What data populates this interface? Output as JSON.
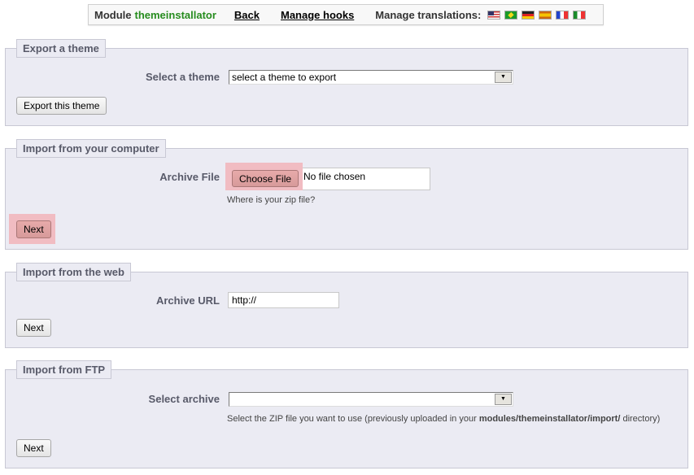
{
  "toolbar": {
    "module_prefix": "Module",
    "module_name": "themeinstallator",
    "back_label": "Back",
    "hooks_label": "Manage hooks",
    "translations_label": "Manage translations:",
    "flags": [
      {
        "icon": "flag-us-icon",
        "lang": "English"
      },
      {
        "icon": "flag-br-icon",
        "lang": "Portuguese"
      },
      {
        "icon": "flag-de-icon",
        "lang": "German"
      },
      {
        "icon": "flag-es-icon",
        "lang": "Spanish"
      },
      {
        "icon": "flag-fr-icon",
        "lang": "French"
      },
      {
        "icon": "flag-it-icon",
        "lang": "Italian"
      }
    ]
  },
  "export": {
    "legend": "Export a theme",
    "select_label": "Select a theme",
    "select_value": "select a theme to export",
    "button": "Export this theme"
  },
  "import_computer": {
    "legend": "Import from your computer",
    "file_label": "Archive File",
    "choose_button": "Choose File",
    "file_status": "No file chosen",
    "hint": "Where is your zip file?",
    "next_button": "Next"
  },
  "import_web": {
    "legend": "Import from the web",
    "url_label": "Archive URL",
    "url_value": "http://",
    "next_button": "Next"
  },
  "import_ftp": {
    "legend": "Import from FTP",
    "select_label": "Select archive",
    "select_value": "",
    "hint_prefix": "Select the ZIP file you want to use (previously uploaded in your ",
    "hint_path": "modules/themeinstallator/import/",
    "hint_suffix": " directory)",
    "next_button": "Next"
  }
}
